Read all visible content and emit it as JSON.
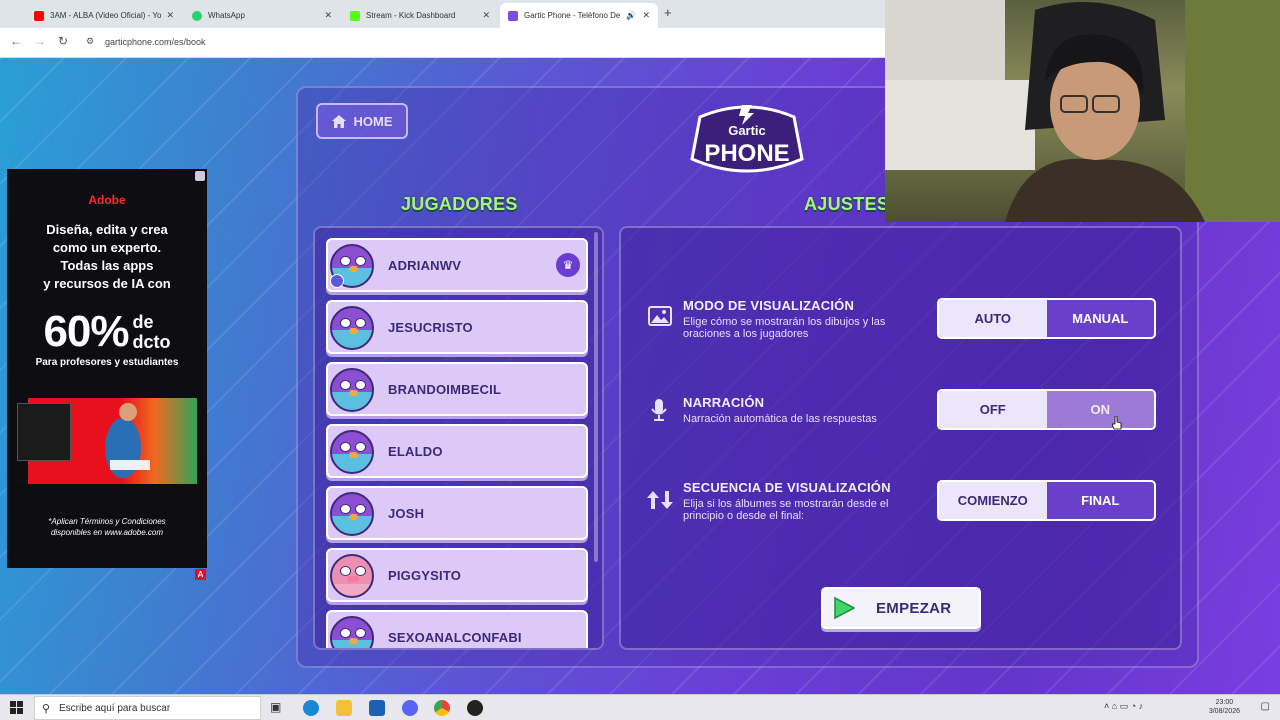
{
  "browser": {
    "tabs": [
      {
        "title": "3AM - ALBA (Video Oficial) - Yo",
        "favicon_color": "#ff0000",
        "active": false
      },
      {
        "title": "WhatsApp",
        "favicon_color": "#25d366",
        "active": false
      },
      {
        "title": "Stream - Kick Dashboard",
        "favicon_color": "#53fc18",
        "active": false
      },
      {
        "title": "Gartic Phone - Teléfono De",
        "favicon_color": "#7b4ce0",
        "active": true
      }
    ],
    "new_tab": "+",
    "url": "garticphone.com/es/book"
  },
  "ad": {
    "brand": "Adobe",
    "headline": [
      "Diseña, edita y crea",
      "como un experto.",
      "Todas las apps",
      "y recursos de IA con"
    ],
    "percent": "60%",
    "percent_suffix": [
      "de",
      "dcto"
    ],
    "subline": "Para profesores y estudiantes",
    "fine_print": [
      "*Aplican Términos y Condiciones",
      "disponibles en www.adobe.com"
    ]
  },
  "game": {
    "home_label": "HOME",
    "logo_top": "Gartic",
    "logo_bottom": "PHONE",
    "players_title": "JUGADORES",
    "settings_title": "AJUSTES",
    "players": [
      {
        "name": "ADRIANWV",
        "avatar": "bird",
        "host": true
      },
      {
        "name": "JESUCRISTO",
        "avatar": "bird",
        "host": false
      },
      {
        "name": "BRANDOIMBECIL",
        "avatar": "bird",
        "host": false
      },
      {
        "name": "ELALDO",
        "avatar": "bird",
        "host": false
      },
      {
        "name": "JOSH",
        "avatar": "bird",
        "host": false
      },
      {
        "name": "PIGGYSITO",
        "avatar": "pig",
        "host": false
      },
      {
        "name": "SEXOANALCONFABI",
        "avatar": "bird",
        "host": false
      }
    ],
    "settings": [
      {
        "icon": "image-icon",
        "title": "MODO DE VISUALIZACIÓN",
        "desc": [
          "Elige cómo se mostrarán los dibujos y las",
          "oraciones a los jugadores"
        ],
        "options": [
          "AUTO",
          "MANUAL"
        ],
        "selected": "AUTO"
      },
      {
        "icon": "microphone-icon",
        "title": "NARRACIÓN",
        "desc": [
          "Narración automática de las respuestas"
        ],
        "options": [
          "OFF",
          "ON"
        ],
        "selected": "OFF"
      },
      {
        "icon": "sort-arrows-icon",
        "title": "SECUENCIA DE VISUALIZACIÓN",
        "desc": [
          "Elija si los álbumes se mostrarán desde el",
          "principio o desde el final:"
        ],
        "options": [
          "COMIENZO",
          "FINAL"
        ],
        "selected": "COMIENZO"
      }
    ],
    "start_label": "EMPEZAR"
  },
  "taskbar": {
    "search_placeholder": "Escribe aquí para buscar",
    "time": "23:00",
    "date": "3/08/2026"
  }
}
